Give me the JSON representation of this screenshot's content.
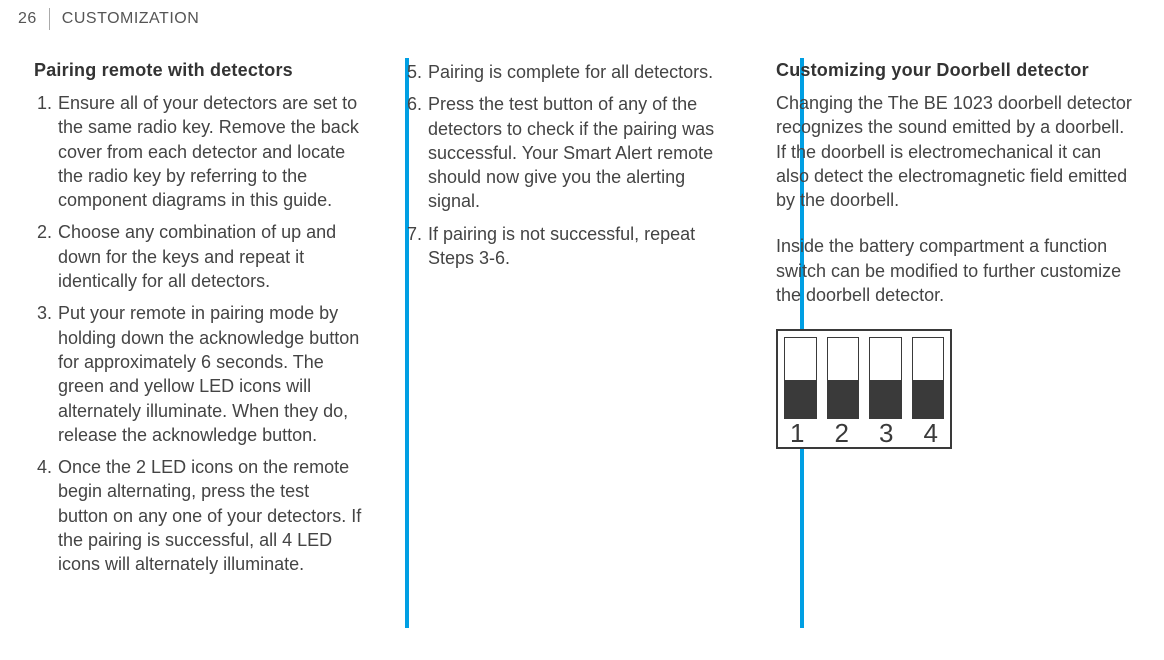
{
  "header": {
    "page_number": "26",
    "section": "CUSTOMIZATION"
  },
  "col1": {
    "heading": "Pairing remote with detectors",
    "items": [
      {
        "n": "1.",
        "t": "Ensure all of your detectors are set to the same radio key. Remove the back cover from each detector and locate the radio key by referring to the component diagrams in this guide."
      },
      {
        "n": "2.",
        "t": "Choose any combination of up and down for the keys and repeat it identically for all detectors."
      },
      {
        "n": "3.",
        "t": "Put your remote in pairing mode by holding down the acknowledge button for approximately 6 seconds. The green and yellow LED icons will alternately illuminate. When they do, release the acknowledge button."
      },
      {
        "n": "4.",
        "t": "Once the 2 LED icons on the remote begin alternating, press the test button on any one of your detectors. If the pairing is successful, all 4 LED icons will alternately illuminate."
      }
    ]
  },
  "col2": {
    "items": [
      {
        "n": "5.",
        "t": "Pairing is complete for all detectors."
      },
      {
        "n": "6.",
        "t": "Press the test button of any of the detectors to check if the pairing was successful. Your Smart Alert remote should now give you the alerting signal."
      },
      {
        "n": "7.",
        "t": "If pairing is not successful, repeat Steps 3-6."
      }
    ]
  },
  "col3": {
    "heading": "Customizing your Doorbell detector",
    "p1": "Changing the The BE 1023 doorbell detector recognizes the sound emitted by a doorbell. If the doorbell is electromechanical it can also detect the electromagnetic field emitted by the doorbell.",
    "p2": "Inside the battery compartment a function switch can be modified to further customize the doorbell detector.",
    "dip_labels": [
      "1",
      "2",
      "3",
      "4"
    ]
  }
}
